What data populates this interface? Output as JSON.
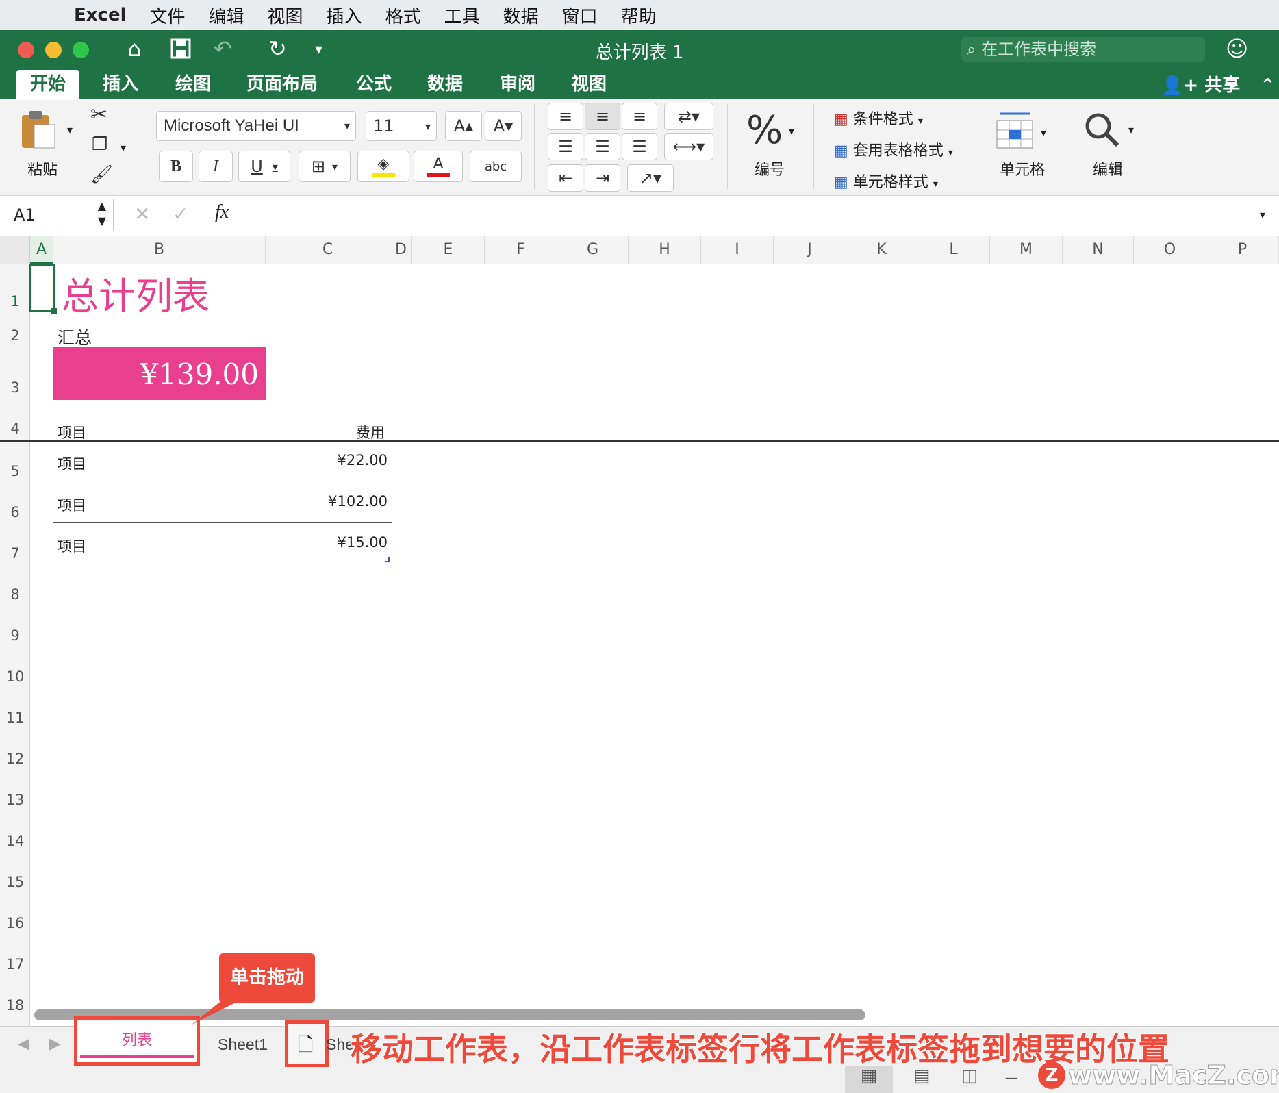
{
  "menubar": {
    "app_name": "Excel",
    "items": [
      "文件",
      "编辑",
      "视图",
      "插入",
      "格式",
      "工具",
      "数据",
      "窗口",
      "帮助"
    ]
  },
  "titlebar": {
    "document_title": "总计列表 1",
    "search_placeholder": "在工作表中搜索"
  },
  "ribbon_tabs": [
    "开始",
    "插入",
    "绘图",
    "页面布局",
    "公式",
    "数据",
    "审阅",
    "视图"
  ],
  "share_label": "共享",
  "ribbon": {
    "paste_label": "粘贴",
    "font_name": "Microsoft YaHei UI",
    "font_size": "11",
    "bold": "B",
    "italic": "I",
    "underline": "U",
    "number_label": "编号",
    "conditional_format": "条件格式",
    "table_format": "套用表格格式",
    "cell_styles": "单元格样式",
    "cells_label": "单元格",
    "edit_label": "编辑",
    "colors": {
      "highlight": "#f7e600",
      "font_color": "#e0141b",
      "accent": "#1f7244"
    }
  },
  "formula_bar": {
    "name_box": "A1",
    "fx": "fx",
    "formula": ""
  },
  "columns": [
    "A",
    "B",
    "C",
    "D",
    "E",
    "F",
    "G",
    "H",
    "I",
    "J",
    "K",
    "L",
    "M",
    "N",
    "O",
    "P"
  ],
  "rows": [
    "1",
    "2",
    "3",
    "4",
    "5",
    "6",
    "7",
    "8",
    "9",
    "10",
    "11",
    "12",
    "13",
    "14",
    "15",
    "16",
    "17",
    "18"
  ],
  "sheet": {
    "title": "总计列表",
    "summary_label": "汇总",
    "total": "¥139.00",
    "header_item": "项目",
    "header_cost": "费用",
    "items": [
      {
        "name": "项目",
        "cost": "¥22.00"
      },
      {
        "name": "项目",
        "cost": "¥102.00"
      },
      {
        "name": "项目",
        "cost": "¥15.00"
      }
    ],
    "accent_color": "#e8408f"
  },
  "sheet_tabs": {
    "active": "列表",
    "other": "Sheet1",
    "partial": "She"
  },
  "annotations": {
    "drag_hint": "单击拖动",
    "caption": "移动工作表，沿工作表标签行将工作表标签拖到想要的位置",
    "watermark": "www.MacZ.com"
  }
}
